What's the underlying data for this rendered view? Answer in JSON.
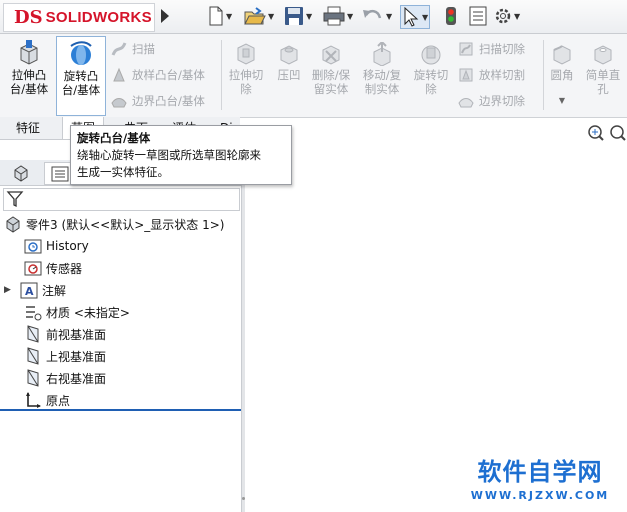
{
  "app": {
    "logo_prefix": "DS",
    "logo_name": "SOLIDWORKS"
  },
  "toolbar": {
    "icons": [
      "new-document-icon",
      "open-folder-icon",
      "save-icon",
      "print-icon",
      "undo-icon",
      "select-pointer-icon",
      "rebuild-traffic-light-icon",
      "file-properties-icon",
      "options-gear-icon"
    ]
  },
  "ribbon": {
    "extruded_boss": "拉伸凸\n台/基体",
    "revolved_boss": "旋转凸\n台/基体",
    "sweep": "扫描",
    "loft": "放样凸台/基体",
    "boundary_boss": "边界凸台/基体",
    "extruded_cut": "拉伸切\n除",
    "hole_wizard": "压凹",
    "delete_keep_body": "删除/保\n留实体",
    "move_copy_body": "移动/复\n制实体",
    "revolved_cut": "旋转切\n除",
    "swept_cut": "扫描切除",
    "lofted_cut": "放样切割",
    "boundary_cut": "边界切除",
    "fillet": "圆角",
    "simple_hole": "简单直\n孔"
  },
  "tabs": {
    "features": "特征",
    "sketch": "草图",
    "evaluate": "评估",
    "dimxpert": "DimXpert",
    "surfaces": "曲面"
  },
  "tooltip": {
    "title": "旋转凸台/基体",
    "line1": "绕轴心旋转一草图或所选草图轮廓来",
    "line2": "生成一实体特征。"
  },
  "tree": {
    "root": "零件3  (默认<<默认>_显示状态 1>)",
    "history": "History",
    "sensors": "传感器",
    "annotations": "注解",
    "material": "材质 <未指定>",
    "front_plane": "前视基准面",
    "top_plane": "上视基准面",
    "right_plane": "右视基准面",
    "origin": "原点"
  },
  "watermark": {
    "line1": "软件自学网",
    "line2": "WWW.RJZXW.COM"
  },
  "colors": {
    "brand_red": "#d5142a",
    "accent_blue": "#1d6fd1",
    "rollback_bar": "#1f5fb3"
  }
}
